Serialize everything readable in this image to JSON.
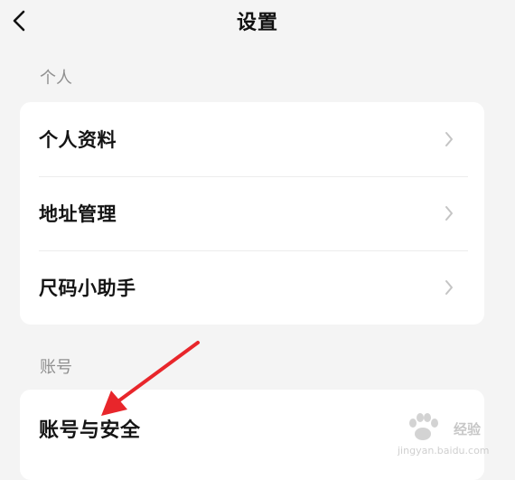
{
  "header": {
    "title": "设置",
    "back_icon": "chevron-left-icon"
  },
  "sections": [
    {
      "label": "个人",
      "items": [
        {
          "label": "个人资料"
        },
        {
          "label": "地址管理"
        },
        {
          "label": "尺码小助手"
        }
      ]
    },
    {
      "label": "账号",
      "items": [
        {
          "label": "账号与安全"
        }
      ]
    }
  ],
  "annotation": {
    "color": "#e8262b",
    "points_to": "账号与安全"
  },
  "watermark": {
    "text": "经验",
    "sub": "jingyan.baidu.com"
  },
  "colors": {
    "background": "#f4f4f4",
    "card": "#ffffff",
    "section_label": "#8f8f8f",
    "chevron": "#c4c4c4"
  }
}
